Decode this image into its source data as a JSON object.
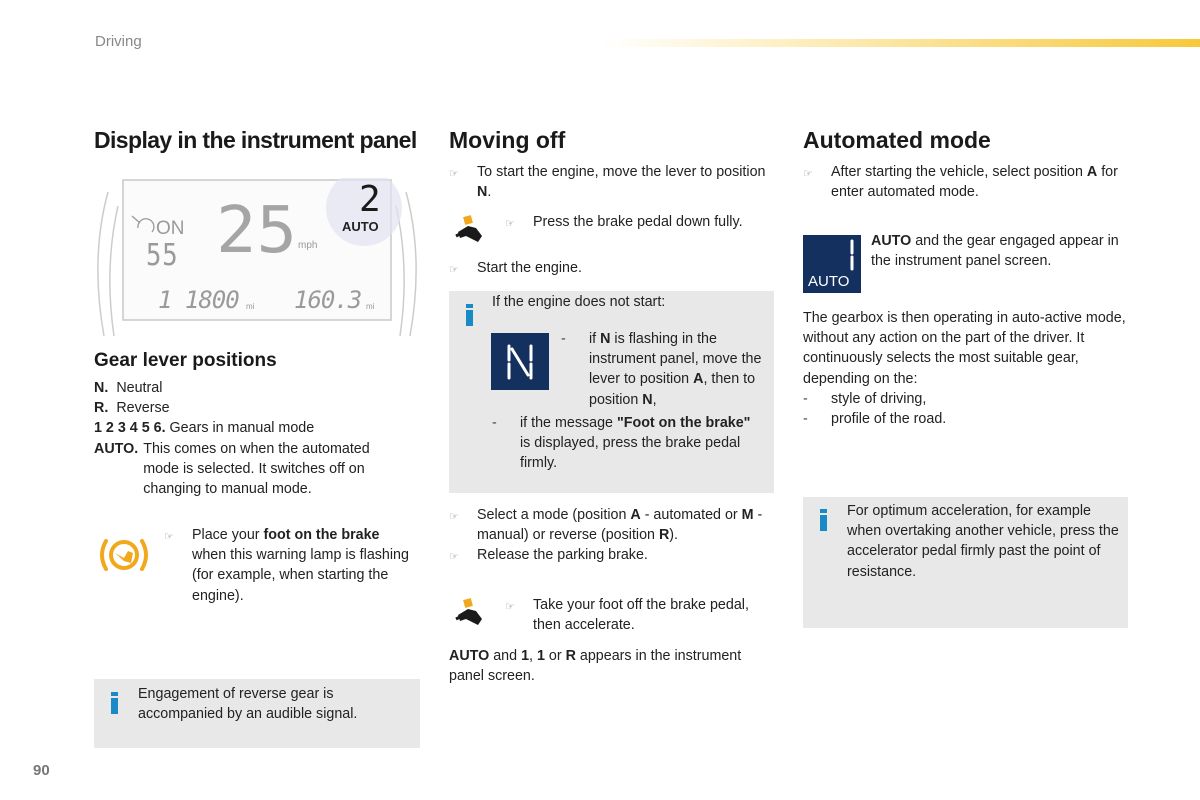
{
  "header": {
    "section": "Driving"
  },
  "page_number": "90",
  "colors": {
    "accent_yellow": "#f7c93a",
    "info_blue": "#1a8ac6",
    "badge_navy": "#14305e",
    "warning_amber": "#f2a81d",
    "info_box_bg": "#e8e8e8"
  },
  "col1": {
    "title": "Display in the instrument panel",
    "panel_display": {
      "cruise_status": "ON",
      "cruise_speed": "55",
      "speed": "25",
      "speed_unit": "mph",
      "gear": "2",
      "mode": "AUTO",
      "odometer": "1 1800",
      "odometer_unit": "mi",
      "trip": "160.3",
      "trip_unit": "mi"
    },
    "gear_title": "Gear lever positions",
    "gears": [
      {
        "key": "N.",
        "desc": "Neutral"
      },
      {
        "key": "R.",
        "desc": "Reverse"
      },
      {
        "key": "1 2 3 4 5 6.",
        "desc": "Gears in manual mode"
      },
      {
        "key": "AUTO.",
        "desc": "This comes on when the automated mode is selected. It switches off on changing to manual mode."
      }
    ],
    "warning": {
      "pre": "Place your ",
      "bold": "foot on the brake",
      "post": " when this warning lamp is flashing (for example, when starting the engine)."
    },
    "info": "Engagement of reverse gear is accompanied by an audible signal."
  },
  "col2": {
    "title": "Moving off",
    "step1": {
      "pre": "To start the engine, move the lever to position ",
      "bold": "N",
      "post": "."
    },
    "step_brake": "Press the brake pedal down fully.",
    "step_start": "Start the engine.",
    "info": {
      "intro": "If the engine does not start:",
      "badge_letter": "N",
      "item1": {
        "a": "if ",
        "b1": "N",
        "c": " is flashing in the instrument panel, move the lever to position ",
        "b2": "A",
        "d": ", then to position ",
        "b3": "N",
        "e": ","
      },
      "item2": {
        "a": "if the message ",
        "b": "\"Foot on the brake\"",
        "c": " is displayed, press the brake pedal firmly."
      }
    },
    "step_mode": {
      "a": "Select a mode (position ",
      "b1": "A",
      "c": " - automated or ",
      "b2": "M",
      "d": " - manual) or reverse (position ",
      "b3": "R",
      "e": ")."
    },
    "step_parking": "Release the parking brake.",
    "step_accel": "Take your foot off the brake pedal, then accelerate.",
    "result": {
      "b1": "AUTO",
      "a": " and ",
      "b2": "1",
      "c": ", ",
      "b3": "1",
      "d": " or ",
      "b4": "R",
      "e": " appears in the instrument panel screen."
    }
  },
  "col3": {
    "title": "Automated mode",
    "step1": {
      "pre": "After starting the vehicle, select position ",
      "bold": "A",
      "post": " for enter automated mode."
    },
    "badge": {
      "gear": "1",
      "label": "AUTO"
    },
    "badge_text": {
      "bold": "AUTO",
      "rest": " and the gear engaged appear in the instrument panel screen."
    },
    "para": "The gearbox is then operating in auto-active mode, without any action on the part of the driver. It continuously selects the most suitable gear, depending on the:",
    "items": [
      "style of driving,",
      "profile of the road."
    ],
    "info": "For optimum acceleration, for example when overtaking another vehicle, press the accelerator pedal firmly past the point of resistance."
  }
}
